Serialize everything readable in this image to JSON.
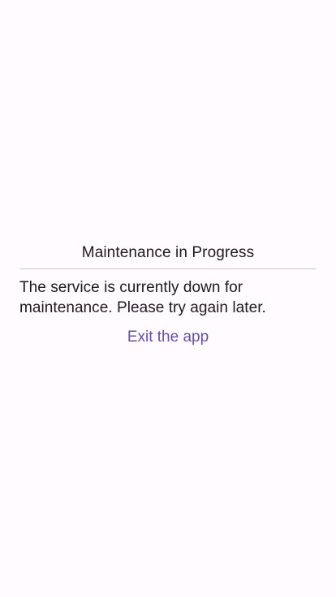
{
  "dialog": {
    "title": "Maintenance in Progress",
    "message": "The service is currently down for maintenance. Please try again later.",
    "exit_label": "Exit the app"
  },
  "colors": {
    "background": "#fffbfe",
    "text": "#1c1b1f",
    "divider": "#cac4d0",
    "accent": "#6750a4"
  }
}
